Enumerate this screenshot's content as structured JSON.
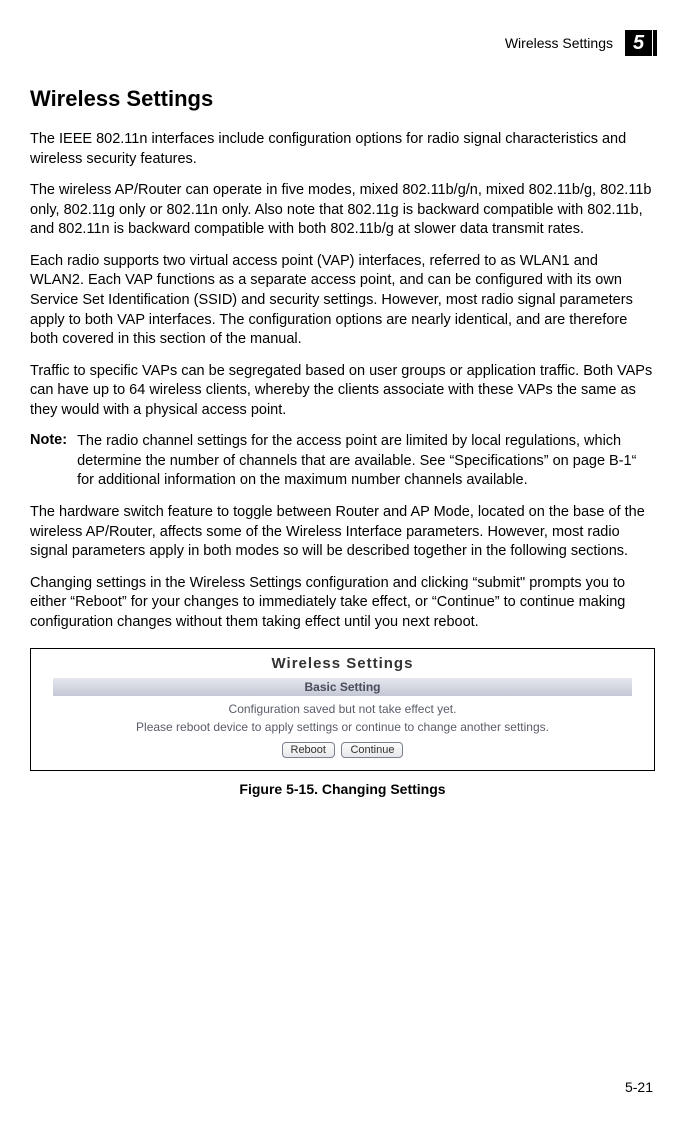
{
  "header": {
    "label": "Wireless Settings",
    "chapter": "5"
  },
  "title": "Wireless Settings",
  "paragraphs": {
    "p1": "The IEEE 802.11n interfaces include configuration options for radio signal characteristics and wireless security features.",
    "p2": "The wireless AP/Router can operate in five modes, mixed 802.11b/g/n, mixed 802.11b/g, 802.11b only, 802.11g only or 802.11n only. Also note that 802.11g is backward compatible with 802.11b, and 802.11n is backward compatible with both 802.11b/g at slower data transmit rates.",
    "p3": "Each radio supports two virtual access point (VAP) interfaces, referred to as WLAN1 and WLAN2. Each VAP functions as a separate access point, and can be configured with its own Service Set Identification (SSID) and security settings. However, most radio signal parameters apply to both VAP interfaces. The configuration options are nearly identical, and are therefore both covered in this section of the manual.",
    "p4": "Traffic to specific VAPs can be segregated based on user groups or application traffic. Both VAPs can have up to 64 wireless clients, whereby the clients associate with these VAPs the same as they would with a physical access point.",
    "p5": "The hardware switch feature to toggle between Router and AP Mode, located on the base of the wireless AP/Router, affects some of the Wireless Interface parameters. However, most radio signal parameters apply in both modes so will be described together in the following sections.",
    "p6": "Changing settings in the Wireless Settings configuration and clicking “submit\" prompts you to either “Reboot” for your changes to immediately take effect, or “Continue” to continue making configuration changes without them taking effect until you next reboot."
  },
  "note": {
    "label": "Note:",
    "body": "The radio channel settings for the access point are limited by local regulations, which determine the number of channels that are available. See “Specifications” on page B-1“ for additional information on the maximum number channels available."
  },
  "figure": {
    "title": "Wireless Settings",
    "bar": "Basic Setting",
    "msg1": "Configuration saved but not take effect yet.",
    "msg2": "Please reboot device to apply settings or continue to change another settings.",
    "btn_reboot": "Reboot",
    "btn_continue": "Continue",
    "caption": "Figure 5-15.   Changing Settings"
  },
  "page_number": "5-21"
}
